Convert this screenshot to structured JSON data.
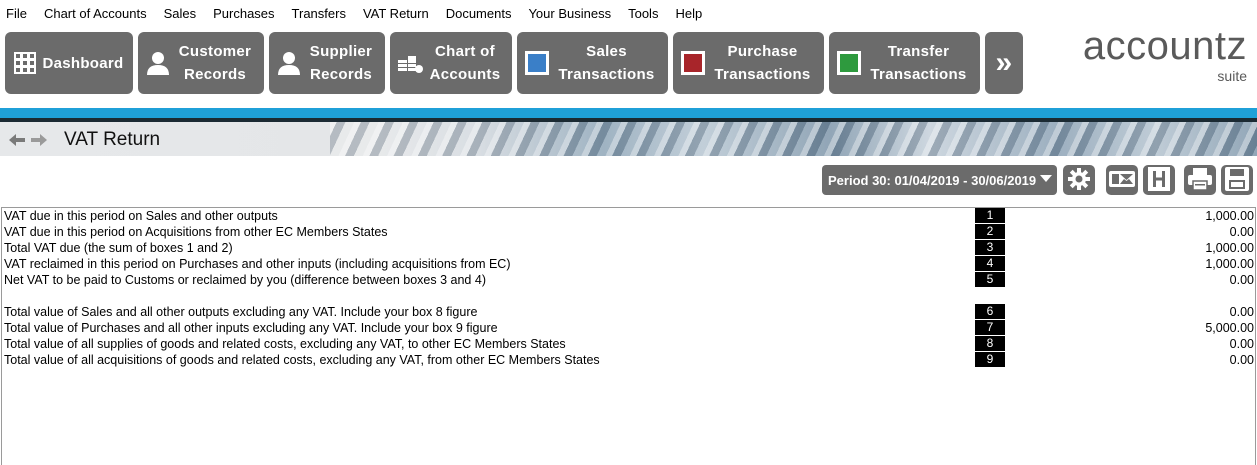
{
  "menu": [
    "File",
    "Chart of Accounts",
    "Sales",
    "Purchases",
    "Transfers",
    "VAT Return",
    "Documents",
    "Your Business",
    "Tools",
    "Help"
  ],
  "toolbar": {
    "dashboard": {
      "label": "Dashboard",
      "icon": "grid-icon"
    },
    "customer": {
      "line1": "Customer",
      "line2": "Records",
      "icon": "person-icon"
    },
    "supplier": {
      "line1": "Supplier",
      "line2": "Records",
      "icon": "person-icon"
    },
    "accounts": {
      "line1": "Chart of",
      "line2": "Accounts",
      "icon": "coins-icon"
    },
    "sales": {
      "line1": "Sales",
      "line2": "Transactions",
      "icon": "blue-square-icon",
      "color": "#3a7fc8"
    },
    "purchase": {
      "line1": "Purchase",
      "line2": "Transactions",
      "icon": "red-square-icon",
      "color": "#a8252a"
    },
    "transfer": {
      "line1": "Transfer",
      "line2": "Transactions",
      "icon": "green-square-icon",
      "color": "#2e9a3e"
    },
    "more": "»"
  },
  "logo": {
    "main": "accountz",
    "sub": "suite"
  },
  "page": {
    "title": "VAT Return"
  },
  "period": {
    "label": "Period 30: 01/04/2019 - 30/06/2019"
  },
  "colors": {
    "accent_blue": "#1fa0d8",
    "button_gray": "#6b6b6b"
  },
  "vat_rows": [
    {
      "desc": "VAT due in this period on Sales and other outputs",
      "box": "1",
      "value": "1,000.00"
    },
    {
      "desc": "VAT due in this period on Acquisitions from other EC Members States",
      "box": "2",
      "value": "0.00"
    },
    {
      "desc": "Total VAT due (the sum of boxes 1 and 2)",
      "box": "3",
      "value": "1,000.00"
    },
    {
      "desc": "VAT reclaimed in this period on Purchases and other inputs (including acquisitions from EC)",
      "box": "4",
      "value": "1,000.00"
    },
    {
      "desc": "Net VAT to be paid to Customs or reclaimed by you (difference between boxes 3 and 4)",
      "box": "5",
      "value": "0.00"
    },
    {
      "desc": "Total value of Sales and all other outputs excluding any VAT. Include your box 8 figure",
      "box": "6",
      "value": "0.00"
    },
    {
      "desc": "Total value of Purchases and all other inputs excluding any VAT. Include your box 9 figure",
      "box": "7",
      "value": "5,000.00"
    },
    {
      "desc": "Total value of all supplies of goods and related costs, excluding any VAT, to other EC Members States",
      "box": "8",
      "value": "0.00"
    },
    {
      "desc": "Total value of all acquisitions of goods and related costs, excluding any VAT, from other EC Members States",
      "box": "9",
      "value": "0.00"
    }
  ]
}
